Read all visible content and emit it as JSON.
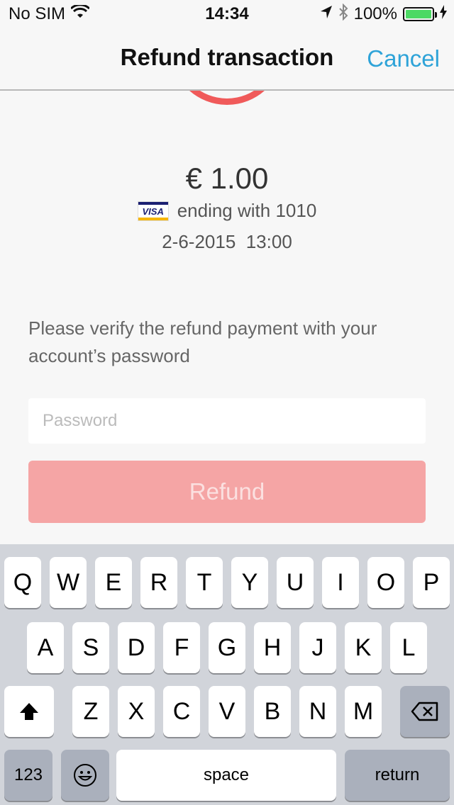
{
  "status_bar": {
    "carrier": "No SIM",
    "time": "14:34",
    "battery": "100%"
  },
  "nav": {
    "title": "Refund transaction",
    "cancel_label": "Cancel"
  },
  "transaction": {
    "amount": "€ 1.00",
    "card_brand": "VISA",
    "card_text": "ending with 1010",
    "datetime": "2-6-2015  13:00"
  },
  "form": {
    "verify_text": "Please verify the refund payment with your account’s password",
    "password_placeholder": "Password",
    "refund_label": "Refund"
  },
  "keyboard": {
    "row1": [
      "Q",
      "W",
      "E",
      "R",
      "T",
      "Y",
      "U",
      "I",
      "O",
      "P"
    ],
    "row2": [
      "A",
      "S",
      "D",
      "F",
      "G",
      "H",
      "J",
      "K",
      "L"
    ],
    "row3": [
      "Z",
      "X",
      "C",
      "V",
      "B",
      "N",
      "M"
    ],
    "numbers_label": "123",
    "space_label": "space",
    "return_label": "return"
  },
  "colors": {
    "accent": "#2ea3d8",
    "refund_button": "#f5a5a5",
    "arc": "#f05a5a",
    "battery": "#4cd964"
  }
}
